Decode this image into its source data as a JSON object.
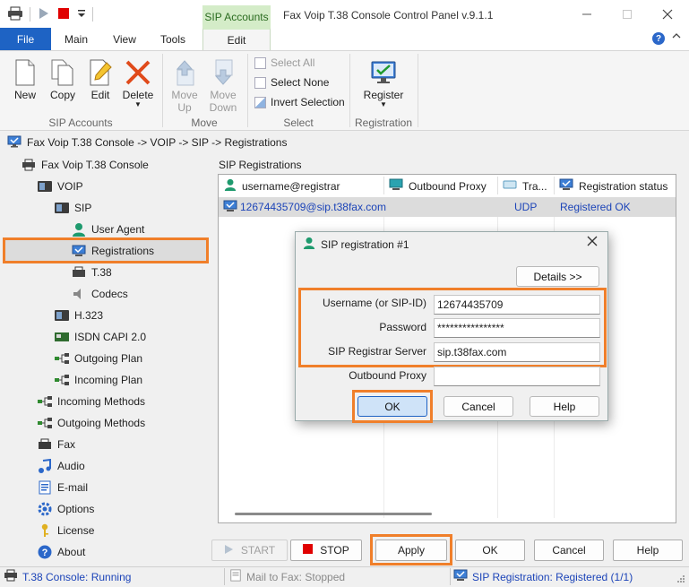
{
  "window": {
    "title": "Fax Voip T.38 Console Control Panel v.9.1.1",
    "context_tab_group": "SIP Accounts"
  },
  "ribbon_tabs": [
    "File",
    "Main",
    "View",
    "Tools",
    "Edit"
  ],
  "ribbon": {
    "sip_accounts": {
      "label": "SIP Accounts",
      "new": "New",
      "copy": "Copy",
      "edit": "Edit",
      "delete": "Delete"
    },
    "move": {
      "label": "Move",
      "move_up_1": "Move",
      "move_up_2": "Up",
      "move_down_1": "Move",
      "move_down_2": "Down"
    },
    "select": {
      "label": "Select",
      "select_all": "Select All",
      "select_none": "Select None",
      "invert_selection": "Invert Selection"
    },
    "registration": {
      "label": "Registration",
      "register": "Register"
    }
  },
  "breadcrumb": "Fax Voip T.38 Console -> VOIP -> SIP -> Registrations",
  "tree": {
    "root": "Fax Voip T.38 Console",
    "voip": "VOIP",
    "sip": "SIP",
    "user_agent": "User Agent",
    "registrations": "Registrations",
    "t38": "T.38",
    "codecs": "Codecs",
    "h323": "H.323",
    "isdn": "ISDN CAPI 2.0",
    "outgoing_plan": "Outgoing Plan",
    "incoming_plan": "Incoming Plan",
    "incoming_methods": "Incoming Methods",
    "outgoing_methods": "Outgoing Methods",
    "fax": "Fax",
    "audio": "Audio",
    "email": "E-mail",
    "options": "Options",
    "license": "License",
    "about": "About"
  },
  "sip_registrations": {
    "group_label": "SIP Registrations",
    "columns": [
      "username@registrar",
      "Outbound Proxy",
      "Tra...",
      "Registration status"
    ],
    "rows": [
      {
        "username": "12674435709@sip.t38fax.com",
        "outbound_proxy": "",
        "transport": "UDP",
        "status": "Registered OK"
      }
    ]
  },
  "dialog": {
    "title": "SIP registration #1",
    "details_button": "Details >>",
    "username_label": "Username (or SIP-ID)",
    "username_value": "12674435709",
    "password_label": "Password",
    "password_value": "****************",
    "registrar_label": "SIP Registrar Server",
    "registrar_value": "sip.t38fax.com",
    "proxy_label": "Outbound Proxy",
    "proxy_value": "",
    "ok": "OK",
    "cancel": "Cancel",
    "help": "Help"
  },
  "bottom_buttons": {
    "start": "START",
    "stop": "STOP",
    "apply": "Apply",
    "ok": "OK",
    "cancel": "Cancel",
    "help": "Help"
  },
  "status_bar": {
    "console": "T.38 Console: Running",
    "mail": "Mail to Fax: Stopped",
    "sip": "SIP Registration: Registered (1/1)"
  },
  "colors": {
    "accent_blue": "#1e63c4",
    "highlight_orange": "#f07f2a",
    "context_green": "#d4ecc8",
    "link_blue": "#1c44b8"
  }
}
